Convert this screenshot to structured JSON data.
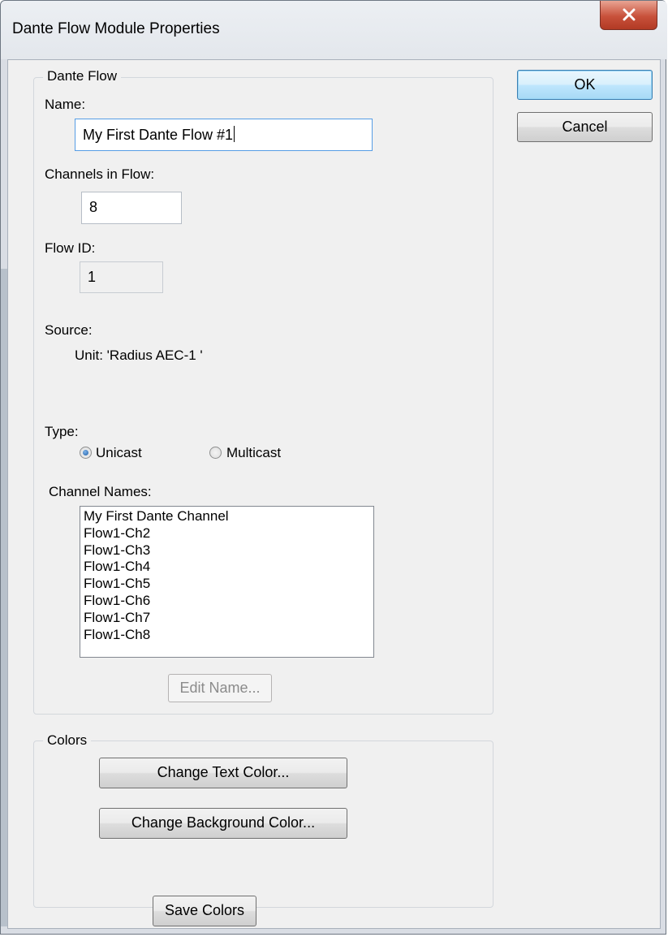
{
  "window": {
    "title": "Dante Flow Module Properties",
    "close_icon": "close-x-icon"
  },
  "dante_flow": {
    "group_label": "Dante Flow",
    "name_label": "Name:",
    "name_value": "My First Dante Flow #1",
    "channels_label": "Channels in Flow:",
    "channels_value": "8",
    "flow_id_label": "Flow ID:",
    "flow_id_value": "1",
    "source_label": "Source:",
    "source_value": "Unit: 'Radius AEC-1 '",
    "type_label": "Type:",
    "type_options": [
      {
        "label": "Unicast",
        "selected": true
      },
      {
        "label": "Multicast",
        "selected": false
      }
    ],
    "channel_names_label": "Channel Names:",
    "channel_names": [
      "My First Dante Channel",
      "Flow1-Ch2",
      "Flow1-Ch3",
      "Flow1-Ch4",
      "Flow1-Ch5",
      "Flow1-Ch6",
      "Flow1-Ch7",
      "Flow1-Ch8"
    ],
    "edit_name_button": "Edit Name...",
    "edit_name_button_enabled": false
  },
  "colors": {
    "group_label": "Colors",
    "change_text_color_button": "Change Text Color...",
    "change_background_color_button": "Change Background Color...",
    "save_colors_button": "Save Colors"
  },
  "actions": {
    "ok_button": "OK",
    "cancel_button": "Cancel"
  },
  "theme": {
    "close_button_color": "#c8513b",
    "focus_border_color": "#569de5",
    "radio_selected_color": "#1d5ea8"
  }
}
